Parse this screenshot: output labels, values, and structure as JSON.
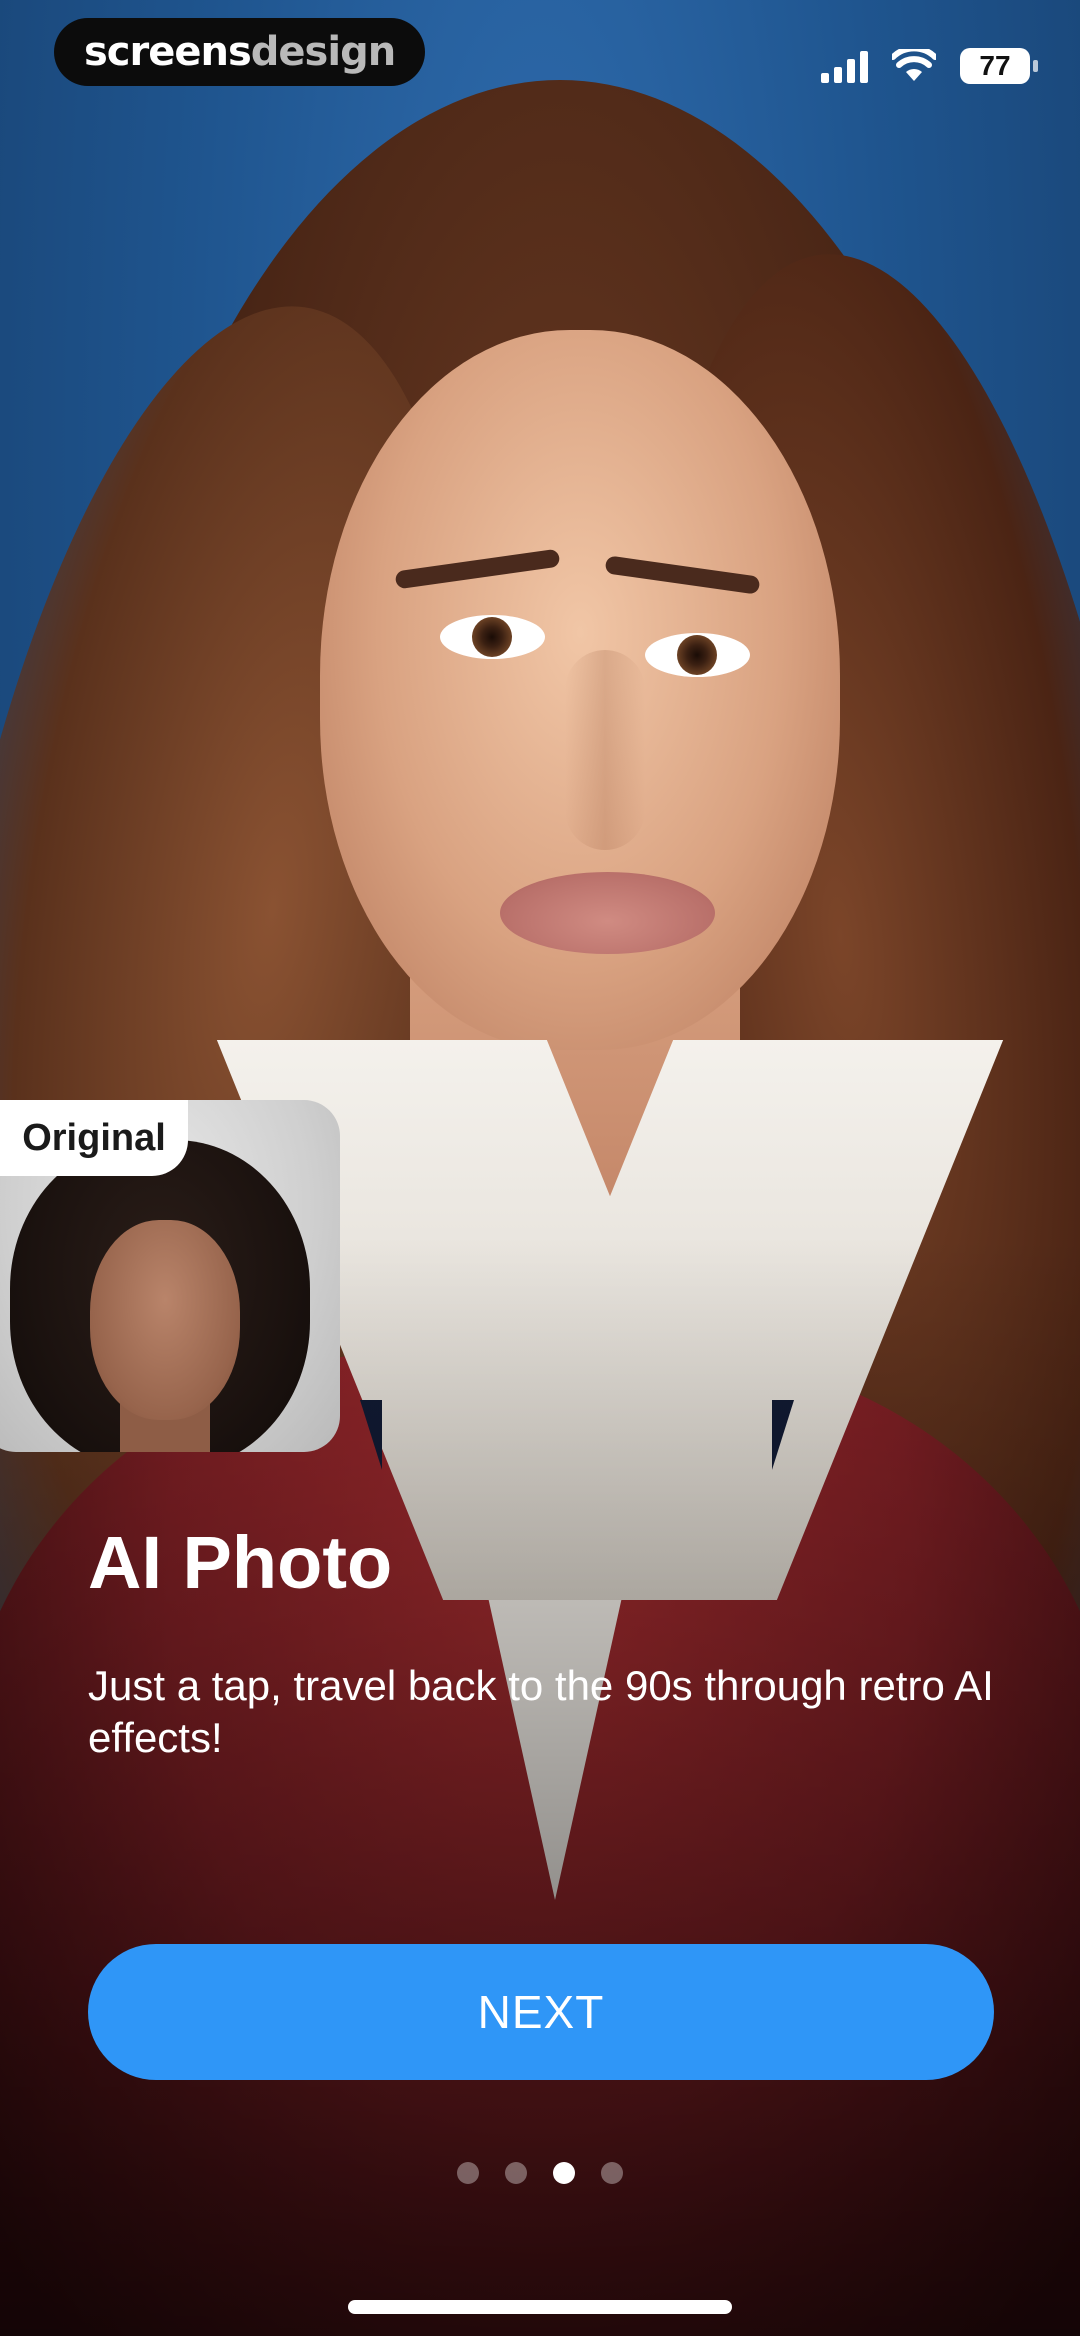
{
  "status_bar": {
    "brand_primary": "screens",
    "brand_secondary": "design",
    "battery_level": "77",
    "icons": [
      "cellular-signal-icon",
      "wifi-icon",
      "battery-icon"
    ]
  },
  "hero": {
    "description": "portrait-photo",
    "original_label": "Original"
  },
  "onboarding": {
    "title": "AI Photo",
    "subtitle": "Just a tap, travel back to the 90s through retro AI effects!",
    "next_label": "NEXT",
    "page_count": 4,
    "current_page": 3
  },
  "colors": {
    "accent": "#2f96f7",
    "background_blue": "#1f558f"
  }
}
